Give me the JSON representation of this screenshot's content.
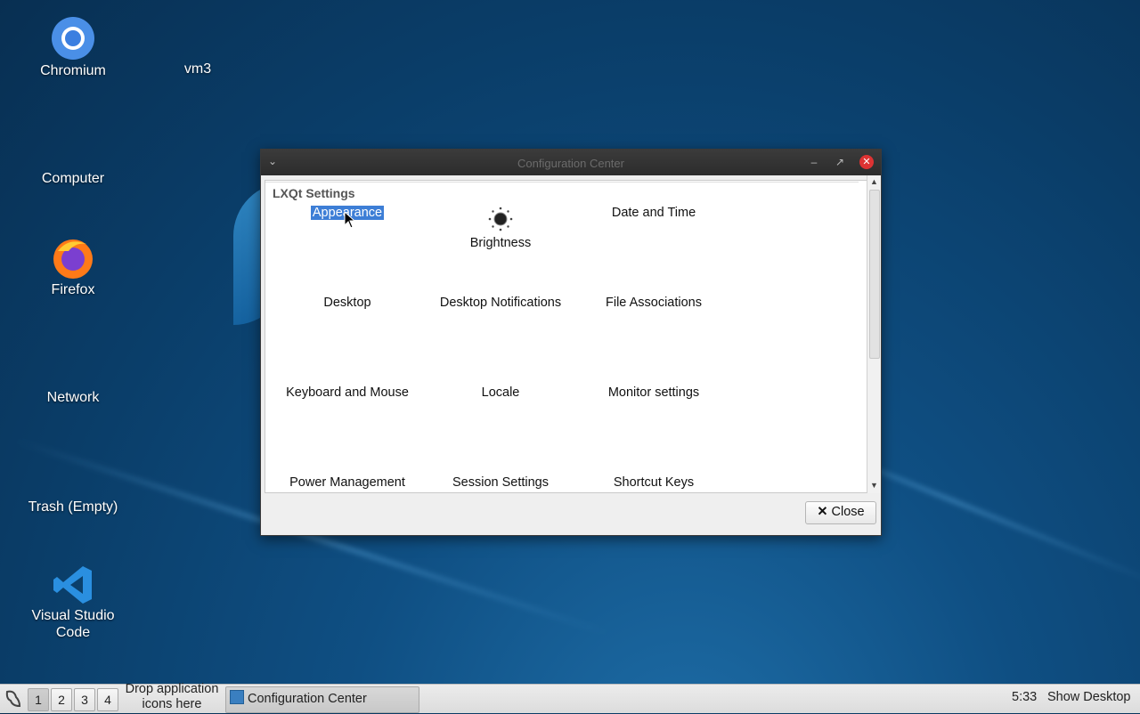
{
  "desktop": {
    "icons": [
      {
        "label": "Chromium"
      },
      {
        "label": "vm3"
      },
      {
        "label": "Computer"
      },
      {
        "label": "Firefox"
      },
      {
        "label": "Network"
      },
      {
        "label": "Trash (Empty)"
      },
      {
        "label": "Visual Studio Code"
      }
    ]
  },
  "window": {
    "title": "Configuration Center",
    "section_title": "LXQt Settings",
    "items": [
      {
        "label": "Appearance",
        "selected": true
      },
      {
        "label": "Brightness",
        "icon": "brightness-icon"
      },
      {
        "label": "Date and Time"
      },
      {
        "label": "Desktop"
      },
      {
        "label": "Desktop Notifications"
      },
      {
        "label": "File Associations"
      },
      {
        "label": "Keyboard and Mouse"
      },
      {
        "label": "Locale"
      },
      {
        "label": "Monitor settings"
      },
      {
        "label": "Power Management"
      },
      {
        "label": "Session Settings"
      },
      {
        "label": "Shortcut Keys"
      }
    ],
    "close_label": "Close"
  },
  "taskbar": {
    "workspaces": [
      "1",
      "2",
      "3",
      "4"
    ],
    "active_workspace": "1",
    "drop_hint": "Drop application icons here",
    "task_label": "Configuration Center",
    "clock": "5:33",
    "show_desktop": "Show Desktop"
  },
  "colors": {
    "selection": "#3d7ed6",
    "close_button": "#dd3333"
  }
}
